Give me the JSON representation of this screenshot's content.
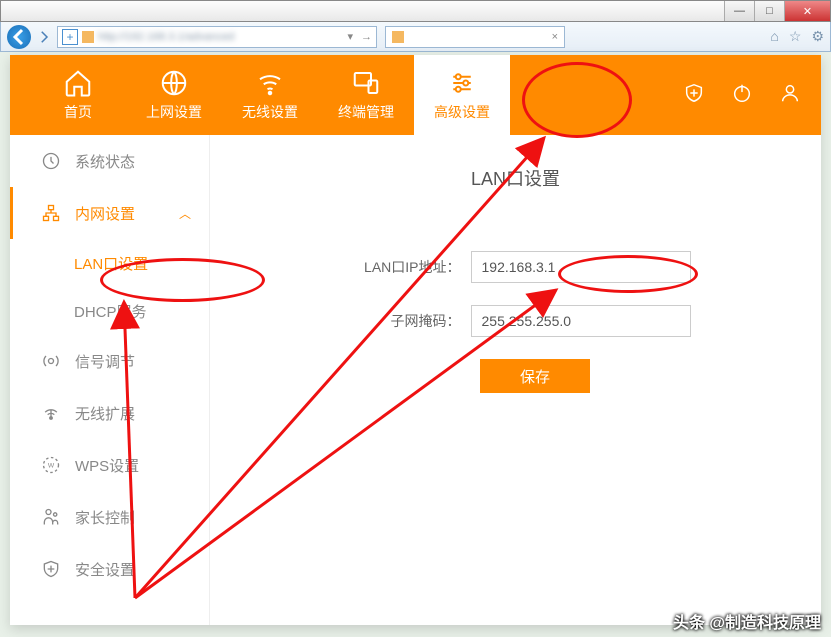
{
  "window": {
    "min": "—",
    "max": "□",
    "close": "✕"
  },
  "browser": {
    "addr_blur": " ",
    "tab_close": "×"
  },
  "topnav": {
    "home": "首页",
    "internet": "上网设置",
    "wireless": "无线设置",
    "terminal": "终端管理",
    "advanced": "高级设置"
  },
  "sidebar": {
    "status": "系统状态",
    "lan": "内网设置",
    "lan_port": "LAN口设置",
    "dhcp": "DHCP服务",
    "signal": "信号调节",
    "wds": "无线扩展",
    "wps": "WPS设置",
    "parental": "家长控制",
    "security": "安全设置"
  },
  "content": {
    "title": "LAN口设置",
    "ip_label": "LAN口IP地址：",
    "ip_value": "192.168.3.1",
    "mask_label": "子网掩码：",
    "mask_value": "255.255.255.0",
    "save": "保存"
  },
  "watermark": "头条 @制造科技原理"
}
